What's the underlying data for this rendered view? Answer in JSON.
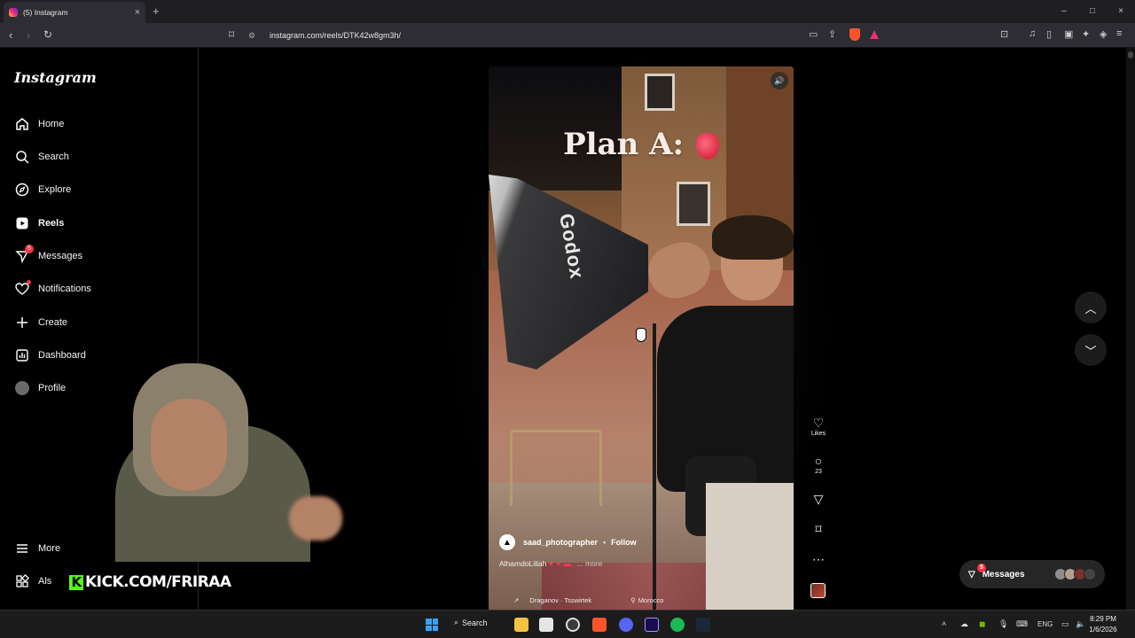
{
  "browser": {
    "tab_title": "(5) Instagram",
    "tab_close": "×",
    "new_tab": "+",
    "url": "instagram.com/reels/DTK42w8gm3h/",
    "window_controls": [
      "–",
      "□",
      "×"
    ]
  },
  "sidebar": {
    "logo": "Instagram",
    "items": [
      {
        "label": "Home",
        "icon": "home-icon"
      },
      {
        "label": "Search",
        "icon": "search-icon"
      },
      {
        "label": "Explore",
        "icon": "compass-icon"
      },
      {
        "label": "Reels",
        "icon": "reels-icon",
        "active": true
      },
      {
        "label": "Messages",
        "icon": "messenger-icon",
        "badge": "5"
      },
      {
        "label": "Notifications",
        "icon": "heart-icon"
      },
      {
        "label": "Create",
        "icon": "plus-icon"
      },
      {
        "label": "Dashboard",
        "icon": "dashboard-icon"
      },
      {
        "label": "Profile",
        "icon": "avatar"
      }
    ],
    "more_label": "More",
    "also_label": "Als"
  },
  "reel": {
    "overlay_text": "Plan A:",
    "softbox_brand": "Godox",
    "author": "saad_photographer",
    "separator": "•",
    "follow_label": "Follow",
    "caption": "AlhamdoLillah",
    "more_label": "... more",
    "audio": "Draganov · Tsswirtek",
    "location": "Morocco"
  },
  "actions": {
    "likes_label": "Likes",
    "comments_count": "23"
  },
  "messages_pill": {
    "label": "Messages",
    "badge": "5"
  },
  "overlay": {
    "kick_url": "KICK.COM/FRIRAA",
    "kick_logo": "K"
  },
  "taskbar": {
    "search_label": "Search",
    "lang": "ENG",
    "time": "8:29 PM",
    "date": "1/6/2026"
  },
  "colors": {
    "badge": "#ff3040",
    "kick_green": "#53fc18",
    "background": "#000000"
  }
}
